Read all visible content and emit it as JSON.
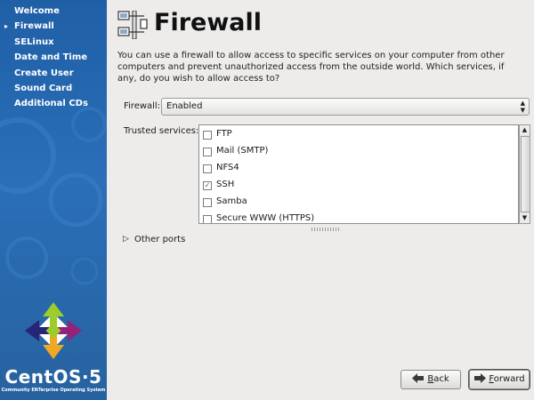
{
  "sidebar": {
    "steps": [
      {
        "label": "Welcome",
        "current": false
      },
      {
        "label": "Firewall",
        "current": true
      },
      {
        "label": "SELinux",
        "current": false
      },
      {
        "label": "Date and Time",
        "current": false
      },
      {
        "label": "Create User",
        "current": false
      },
      {
        "label": "Sound Card",
        "current": false
      },
      {
        "label": "Additional CDs",
        "current": false
      }
    ],
    "current_marker": "▸",
    "brand": "CentOS·5",
    "tagline": "Community ENTerprise Operating System"
  },
  "header": {
    "title": "Firewall",
    "icon": "firewall-icon"
  },
  "intro_text": "You can use a firewall to allow access to specific services on your computer from other computers and prevent unauthorized access from the outside world.  Which services, if any, do you wish to allow access to?",
  "firewall": {
    "label": "Firewall:",
    "value": "Enabled"
  },
  "trusted_services": {
    "label": "Trusted services:",
    "items": [
      {
        "label": "FTP",
        "checked": false
      },
      {
        "label": "Mail (SMTP)",
        "checked": false
      },
      {
        "label": "NFS4",
        "checked": false
      },
      {
        "label": "SSH",
        "checked": true
      },
      {
        "label": "Samba",
        "checked": false
      },
      {
        "label": "Secure WWW (HTTPS)",
        "checked": false
      }
    ]
  },
  "other_ports": {
    "label": "Other ports",
    "expanded": false
  },
  "buttons": {
    "back": {
      "label": "Back",
      "mnemonic": "B"
    },
    "forward": {
      "label": "Forward",
      "mnemonic": "F"
    }
  },
  "colors": {
    "sidebar": "#2a6fb8",
    "background": "#edeceb"
  }
}
